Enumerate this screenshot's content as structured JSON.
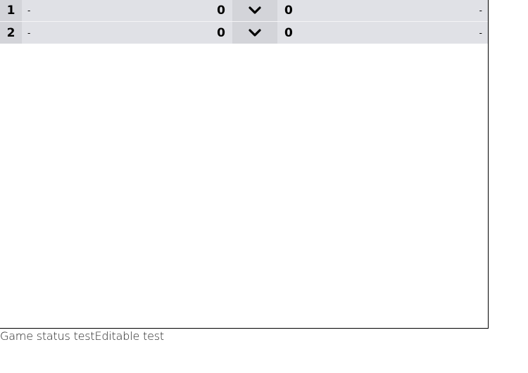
{
  "games": [
    {
      "number": "1",
      "home_name": "-",
      "home_score": "0",
      "toggle_icon": "chevron-down-icon",
      "away_score": "0",
      "away_name": "-"
    },
    {
      "number": "2",
      "home_name": "-",
      "home_score": "0",
      "toggle_icon": "chevron-down-icon",
      "away_score": "0",
      "away_name": "-"
    }
  ],
  "footer": {
    "game_status": "Game status test",
    "editable": "Editable test"
  },
  "colors": {
    "row_background": "#e0e1e6",
    "cell_accent": "#d3d4d9",
    "panel_border": "#000000"
  }
}
